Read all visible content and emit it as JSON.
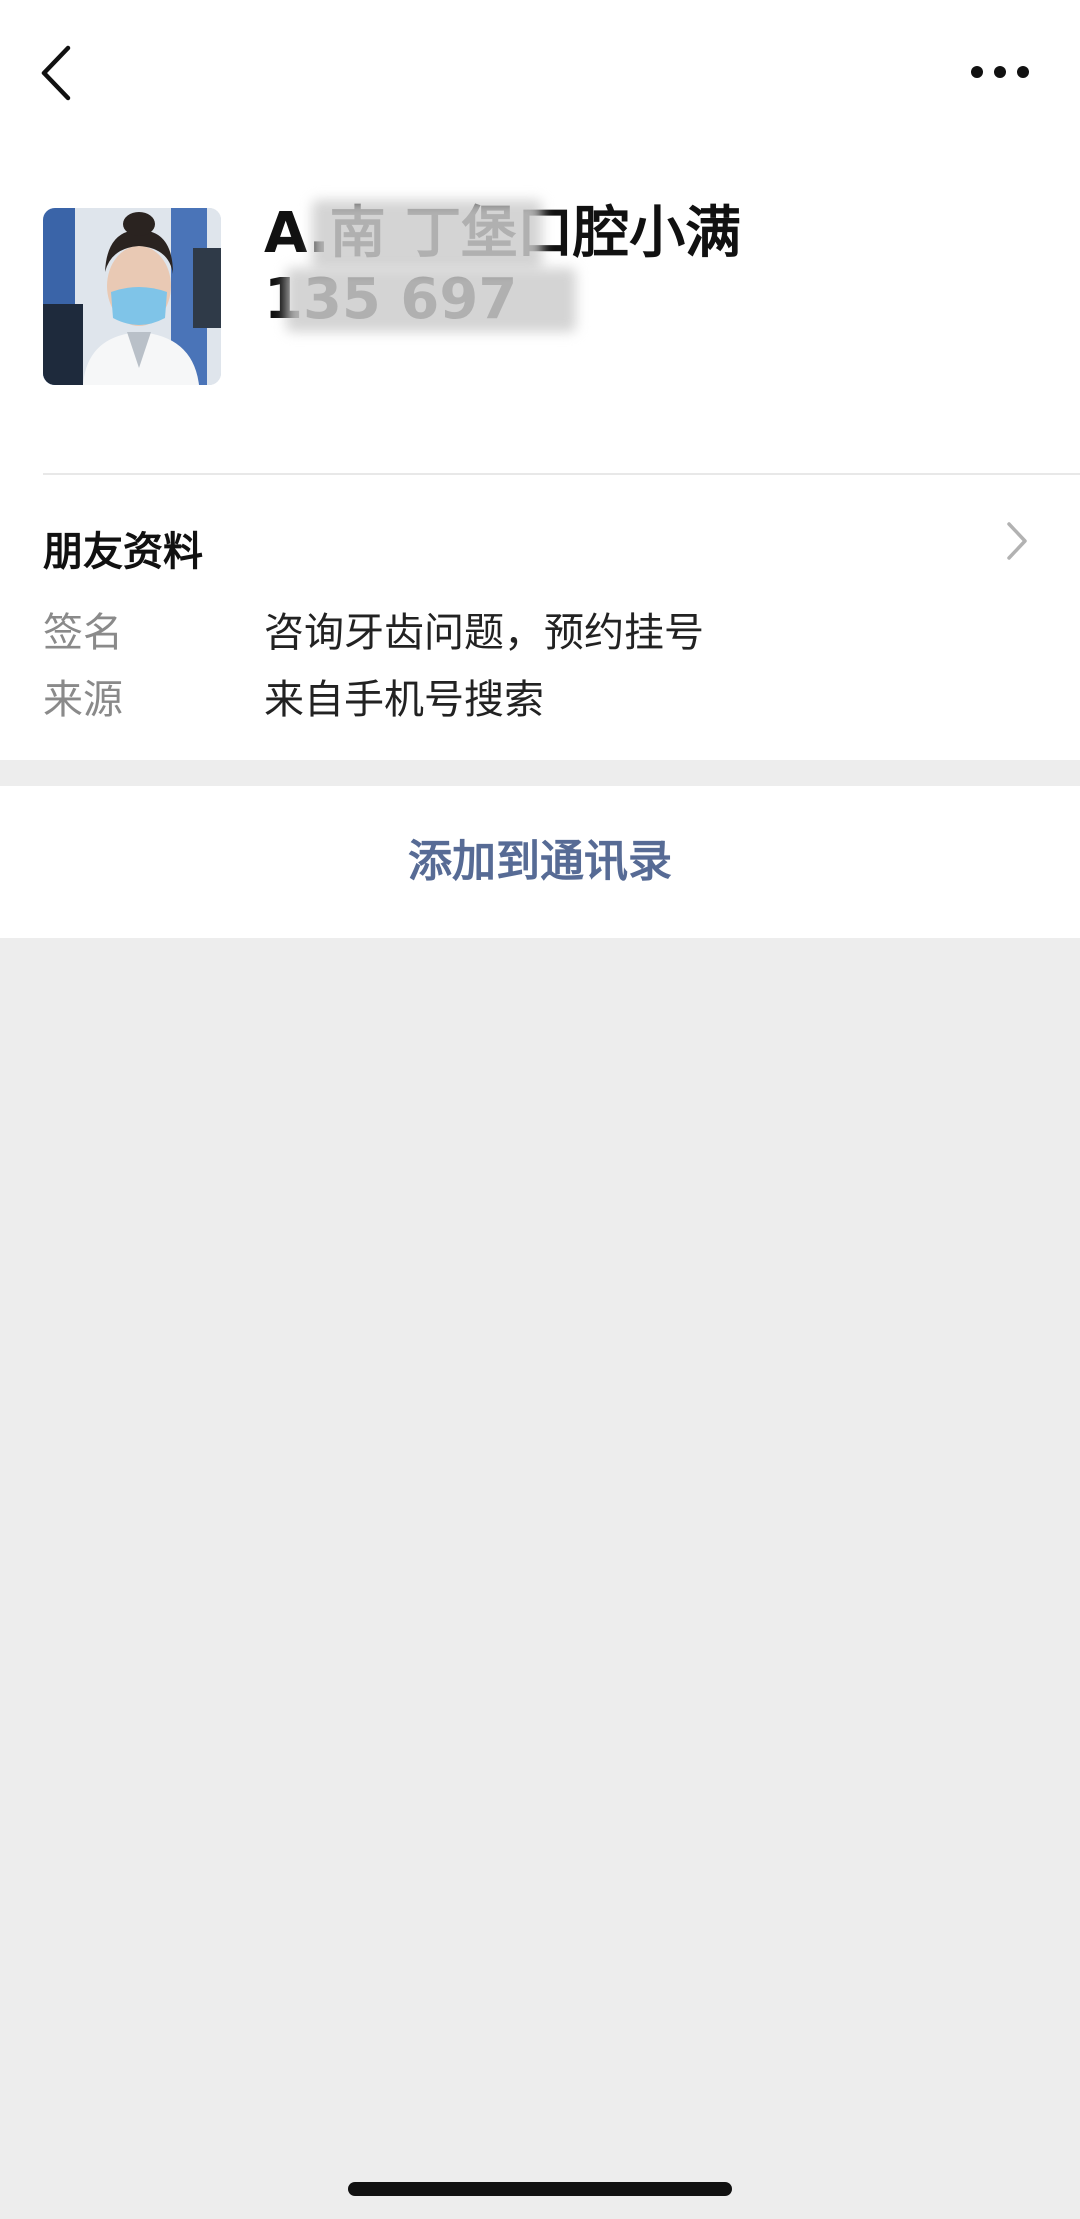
{
  "header": {
    "back_icon": "back-chevron-icon",
    "more_icon": "more-dots-icon"
  },
  "profile": {
    "name": "A.南 丁堡口腔小满",
    "id": "135 697"
  },
  "friend_info": {
    "label": "朋友资料",
    "chevron_icon": "chevron-right-icon"
  },
  "details": [
    {
      "key": "签名",
      "value": "咨询牙齿问题，预约挂号"
    },
    {
      "key": "来源",
      "value": "来自手机号搜索"
    }
  ],
  "action": {
    "add_contact_label": "添加到通讯录"
  },
  "colors": {
    "link_blue": "#576b95",
    "background_gray": "#ededed",
    "key_gray": "#8a8a8a"
  }
}
